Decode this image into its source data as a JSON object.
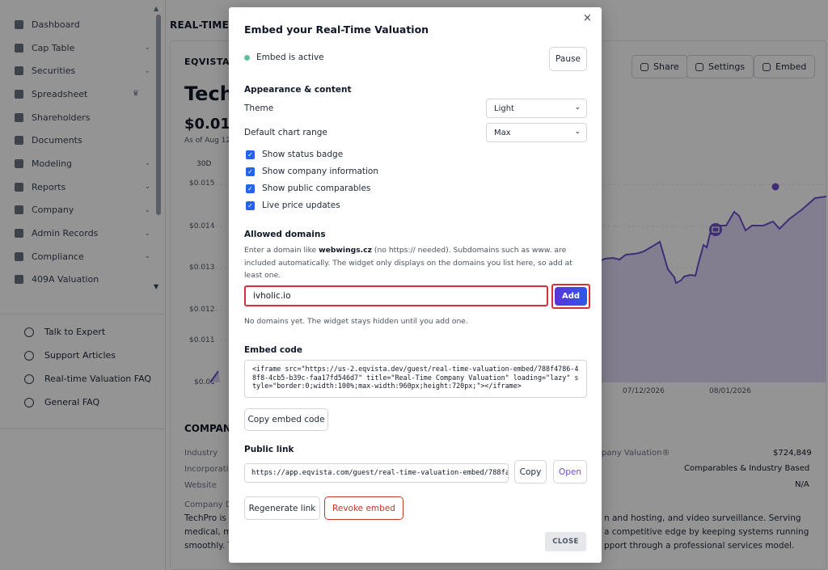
{
  "sidebar": {
    "items": [
      {
        "label": "Dashboard",
        "chev": ""
      },
      {
        "label": "Cap Table",
        "chev": "⌄"
      },
      {
        "label": "Securities",
        "chev": "⌄"
      },
      {
        "label": "Spreadsheet",
        "chev": "♛"
      },
      {
        "label": "Shareholders",
        "chev": ""
      },
      {
        "label": "Documents",
        "chev": ""
      },
      {
        "label": "Modeling",
        "chev": "⌄"
      },
      {
        "label": "Reports",
        "chev": "⌄"
      },
      {
        "label": "Company",
        "chev": "⌄"
      },
      {
        "label": "Admin Records",
        "chev": "⌄"
      },
      {
        "label": "Compliance",
        "chev": "⌄"
      },
      {
        "label": "409A Valuation",
        "chev": ""
      }
    ],
    "help": [
      "Talk to Expert",
      "Support Articles",
      "Real-time Valuation FAQ",
      "General FAQ"
    ]
  },
  "main": {
    "title": "REAL-TIME C",
    "eq_label": "EQVISTA P",
    "company_name": "Tech",
    "price": "$0.01",
    "as_of": "As of Aug 12",
    "range": "30D",
    "buttons": {
      "share": "Share",
      "settings": "Settings",
      "embed": "Embed"
    },
    "company_heading": "COMPANY",
    "info": {
      "industry_label": "Industry",
      "incorporation_label": "Incorporatio",
      "website_label": "Website",
      "company_desc_label": "Company D",
      "valuation_label": "pany Valuation®",
      "valuation_value": "$724,849",
      "method_value": "Comparables & Industry Based",
      "website_value": "N/A"
    },
    "desc_left": [
      "TechPro is a",
      "medical, m",
      "smoothly. T"
    ],
    "desc_right": [
      "n and hosting, and video surveillance. Serving",
      "a competitive edge by keeping systems running",
      "pport through a professional services model."
    ]
  },
  "chart_data": {
    "type": "area",
    "y_ticks": [
      "$0.015",
      "$0.014",
      "$0.013",
      "$0.012",
      "$0.011",
      "$0.01"
    ],
    "x_ticks": [
      "07/12/2026",
      "08/01/2026"
    ],
    "color": "#6d4fcf"
  },
  "modal": {
    "title": "Embed your Real-Time Valuation",
    "close_icon": "×",
    "status_text": "Embed is active",
    "pause_label": "Pause",
    "appearance_heading": "Appearance & content",
    "theme_label": "Theme",
    "theme_value": "Light",
    "chart_range_label": "Default chart range",
    "chart_range_value": "Max",
    "checkboxes": [
      "Show status badge",
      "Show company information",
      "Show public comparables",
      "Live price updates"
    ],
    "domains_heading": "Allowed domains",
    "help_pre": "Enter a domain like ",
    "help_example": "webwings.cz",
    "help_post": " (no https:// needed). Subdomains such as www. are included automatically. The widget only displays on the domains you list here, so add at least one.",
    "domain_input_value": "ivholic.io",
    "add_label": "Add",
    "no_domains_text": "No domains yet. The widget stays hidden until you add one.",
    "embed_code_heading": "Embed code",
    "embed_code": "<iframe src=\"https://us-2.eqvista.dev/guest/real-time-valuation-embed/788f4786-48f8-4cb5-b39c-faa17fd546d7\" title=\"Real-Time Company Valuation\" loading=\"lazy\" style=\"border:0;width:100%;max-width:960px;height:720px;\"></iframe>",
    "copy_embed_label": "Copy embed code",
    "public_link_heading": "Public link",
    "public_link": "https://app.eqvista.com/guest/real-time-valuation-embed/788fa",
    "copy_label": "Copy",
    "open_label": "Open",
    "regenerate_label": "Regenerate link",
    "revoke_label": "Revoke embed",
    "close_label": "CLOSE"
  }
}
